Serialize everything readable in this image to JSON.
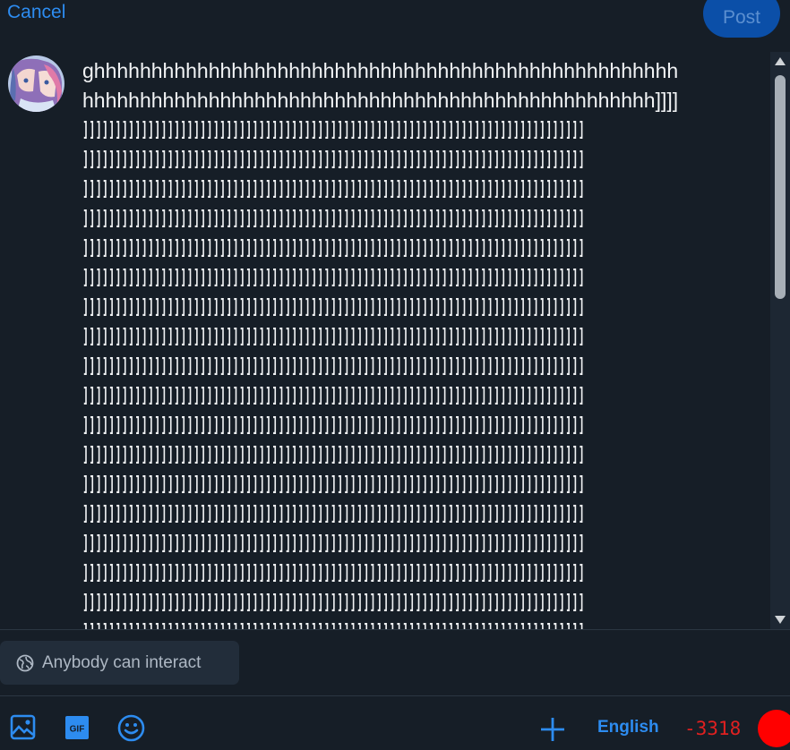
{
  "header": {
    "cancel_label": "Cancel",
    "post_label": "Post"
  },
  "composer": {
    "line1": "ghhhhhhhhhhhhhhhhhhhhhhhhhhhhhhhhhhhhhhhhhhhhhhhhhhh",
    "line2": "hhhhhhhhhhhhhhhhhhhhhhhhhhhhhhhhhhhhhhhhhhhhhhhhhh]]]]",
    "bracket_line": "]]]]]]]]]]]]]]]]]]]]]]]]]]]]]]]]]]]]]]]]]]]]]]]]]]]]]]]]]]]]]]]]]]]]]]]]]]]]]",
    "bracket_line_count": 18
  },
  "controls": {
    "interaction_label": "Anybody can interact",
    "language_label": "English",
    "char_count": "-3318"
  },
  "icons": {
    "image": "image-icon",
    "gif": "gif-icon",
    "emoji": "emoji-icon",
    "add": "plus-icon",
    "interaction": "earth-icon"
  },
  "colors": {
    "background": "#161e27",
    "accent": "#2d8cf0",
    "post_button": "#0b4fa8",
    "over_limit": "#ff0000"
  }
}
